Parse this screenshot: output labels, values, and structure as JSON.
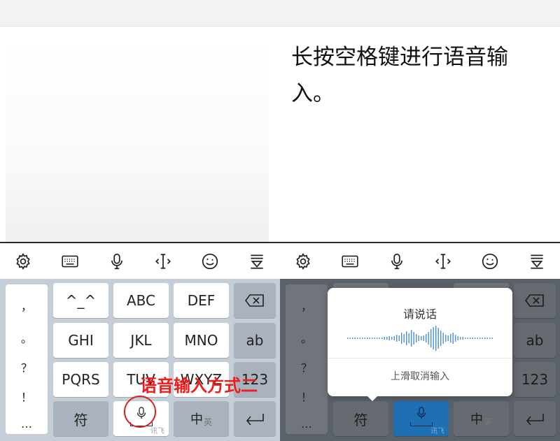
{
  "left": {
    "toolbar_icons": [
      "gear-icon",
      "keyboard-icon",
      "microphone-icon",
      "text-cursor-icon",
      "emoji-icon",
      "collapse-keyboard-icon"
    ],
    "punctuation": [
      "，",
      "。",
      "？",
      "！",
      "…"
    ],
    "keys": {
      "row1": [
        "^_^",
        "ABC",
        "DEF"
      ],
      "row2": [
        "GHI",
        "JKL",
        "MNO"
      ],
      "row3": [
        "PQRS",
        "TUV",
        "WXYZ"
      ],
      "ab": "ab",
      "num": "123",
      "fu": "符",
      "zhong": "中",
      "ying": "英",
      "brand": "讯飞",
      "backspace_icon": "backspace-icon",
      "enter_icon": "enter-icon"
    },
    "annotation": "语音输入方式二"
  },
  "right": {
    "content_text": "长按空格键进行语音输入。",
    "toolbar_icons": [
      "gear-icon",
      "keyboard-icon",
      "microphone-icon",
      "text-cursor-icon",
      "emoji-icon",
      "collapse-keyboard-icon"
    ],
    "punctuation": [
      "，",
      "。",
      "？",
      "！",
      "…"
    ],
    "keys": {
      "ab": "ab",
      "num": "123",
      "fu": "符",
      "zhong": "中",
      "ying": "英",
      "brand": "讯飞"
    },
    "popup": {
      "title": "请说话",
      "hint": "上滑取消输入"
    },
    "colors": {
      "voice_accent": "#1f6fb3",
      "wave_blue": "#4a90d9"
    }
  }
}
